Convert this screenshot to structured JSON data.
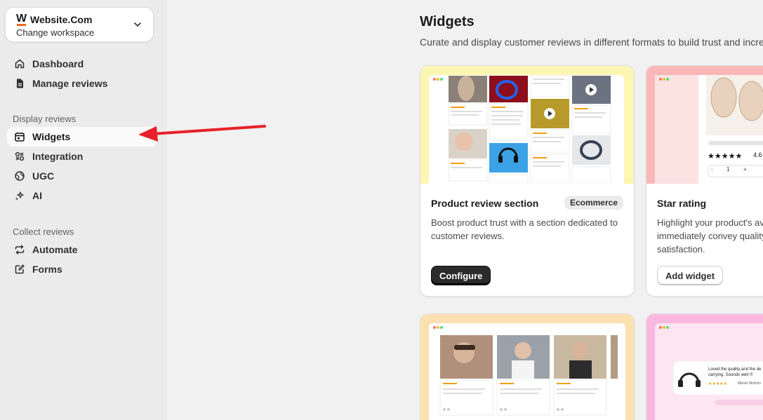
{
  "workspace": {
    "name": "Website.Com",
    "subtitle": "Change workspace",
    "logo_letter": "W"
  },
  "nav": {
    "top": [
      {
        "label": "Dashboard",
        "icon": "home-icon"
      },
      {
        "label": "Manage reviews",
        "icon": "document-icon"
      }
    ],
    "display_section": "Display reviews",
    "display": [
      {
        "label": "Widgets",
        "icon": "widget-icon",
        "active": true
      },
      {
        "label": "Integration",
        "icon": "integration-icon"
      },
      {
        "label": "UGC",
        "icon": "globe-icon"
      },
      {
        "label": "AI",
        "icon": "sparkle-icon"
      }
    ],
    "collect_section": "Collect reviews",
    "collect": [
      {
        "label": "Automate",
        "icon": "repeat-icon"
      },
      {
        "label": "Forms",
        "icon": "edit-form-icon"
      }
    ]
  },
  "page": {
    "title": "Widgets",
    "description": "Curate and display customer reviews in different formats to build trust and incre"
  },
  "cards": [
    {
      "title": "Product review section",
      "badge": "Ecommerce",
      "description": "Boost product trust with a section dedicated to customer reviews.",
      "button": "Configure"
    },
    {
      "title": "Star rating",
      "description": "Highlight your product's av immediately convey quality satisfaction.",
      "button": "Add widget",
      "rating": "4.6",
      "qty_minus": "-",
      "qty_value": "1",
      "qty_plus": "+"
    },
    {
      "title": "",
      "description": ""
    },
    {
      "title": "",
      "description": "",
      "popup_text": "Loved the quality and the de carrying. Sounds well !!!",
      "popup_author": "Marvin McKinn"
    }
  ],
  "colors": {
    "accent_arrow": "#e8202a",
    "card1_bg": "#fdf6b2",
    "card2_bg": "#fbb7b7",
    "card3_bg": "#fde0b0",
    "card4_bg": "#fab8de"
  }
}
